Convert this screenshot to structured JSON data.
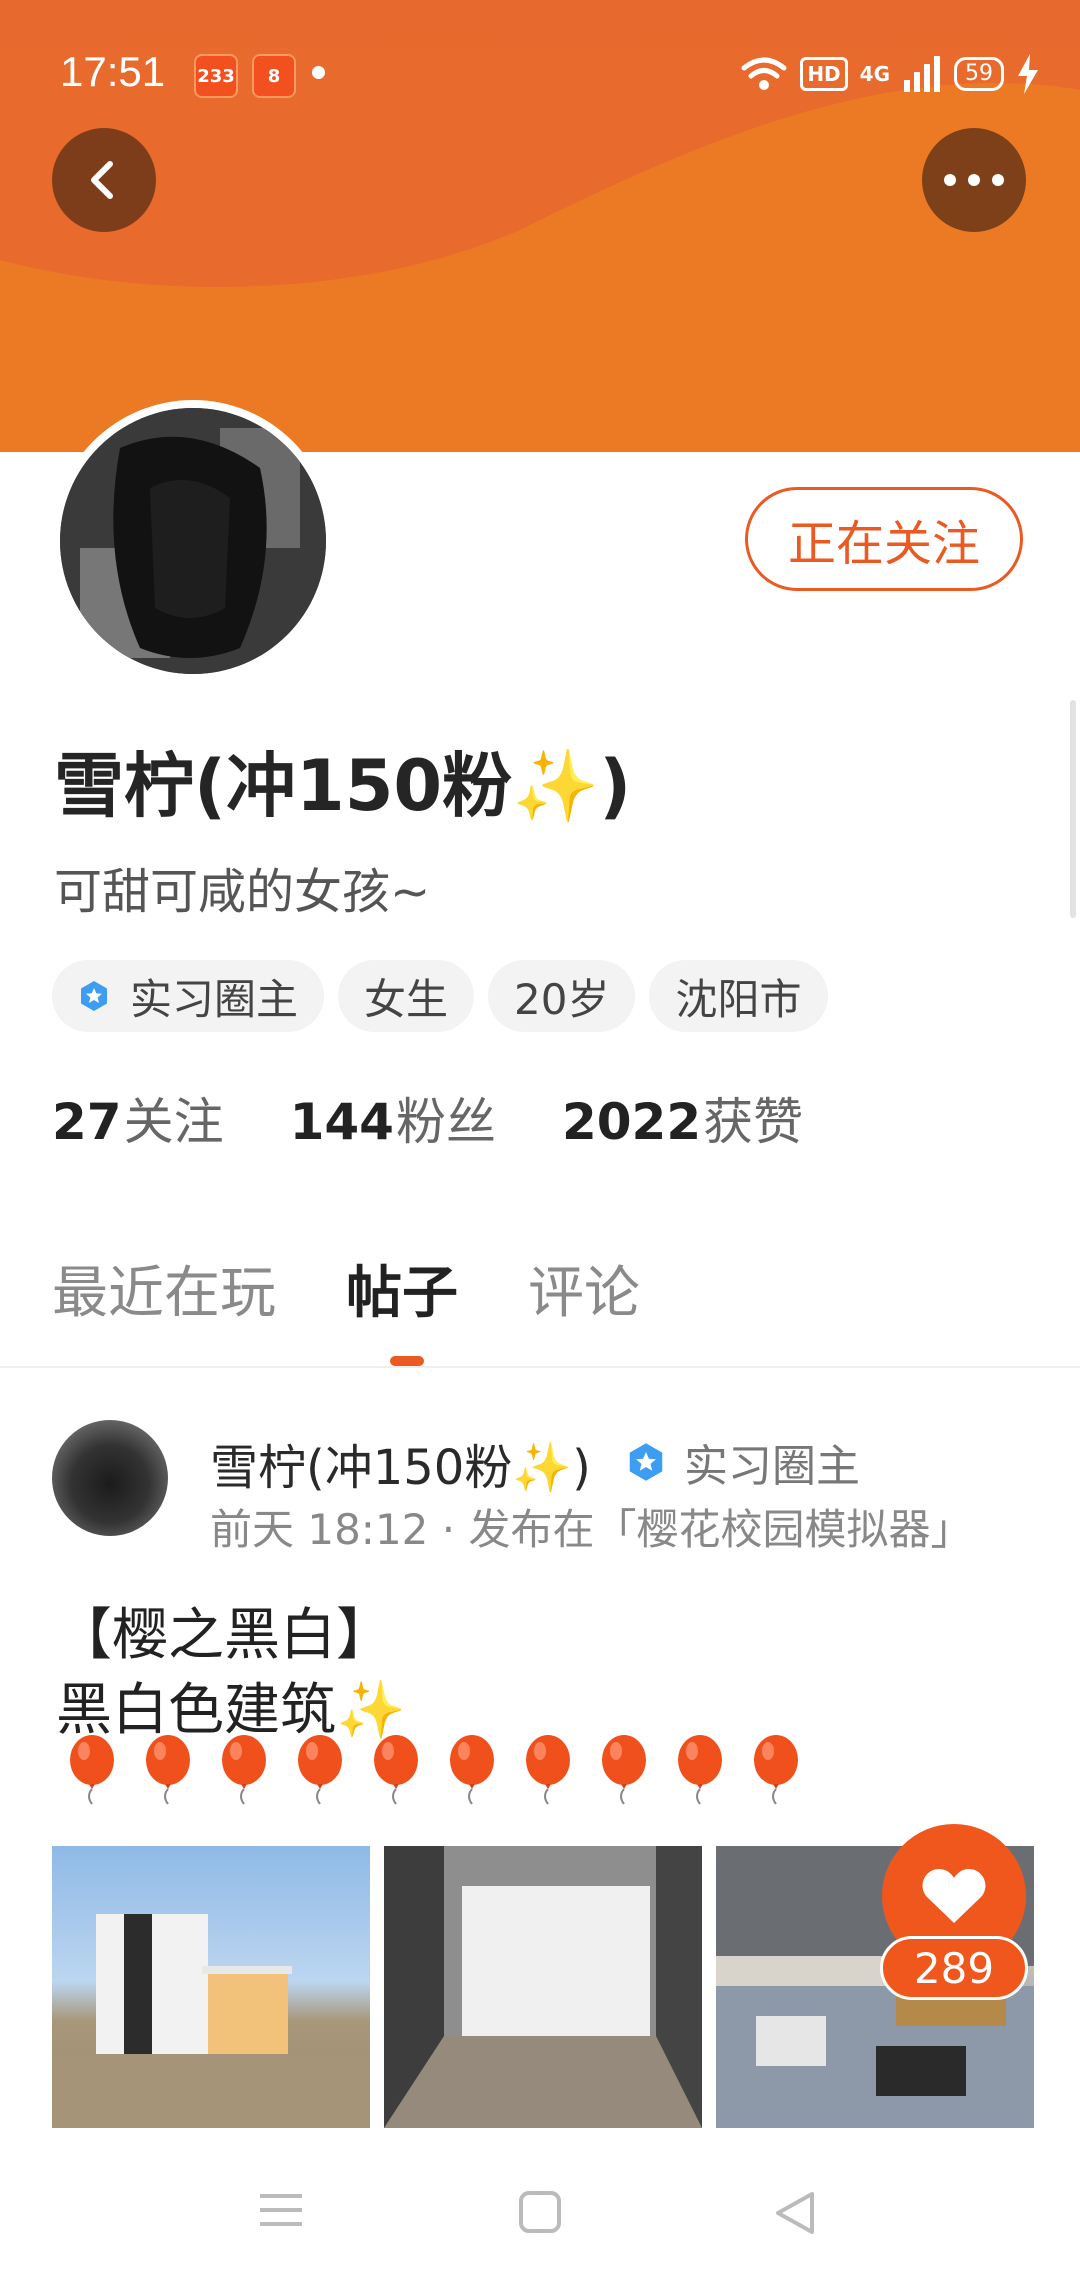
{
  "status": {
    "time": "17:51",
    "app_badge_1": "233",
    "app_badge_2": "8",
    "hd": "HD",
    "network": "4G",
    "battery": "59"
  },
  "profile": {
    "follow_button": "正在关注",
    "name": "雪柠(冲150粉✨)",
    "bio": "可甜可咸的女孩~",
    "tags": [
      "实习圈主",
      "女生",
      "20岁",
      "沈阳市"
    ],
    "stats": [
      {
        "num": "27",
        "label": "关注"
      },
      {
        "num": "144",
        "label": "粉丝"
      },
      {
        "num": "2022",
        "label": "获赞"
      }
    ]
  },
  "tabs": [
    "最近在玩",
    "帖子",
    "评论"
  ],
  "active_tab": "帖子",
  "post": {
    "author": "雪柠(冲150粉✨)",
    "badge": "实习圈主",
    "meta": "前天 18:12 · 发布在「樱花校园模拟器」",
    "title": "【樱之黑白】",
    "subtitle": "黑白色建筑✨",
    "balloon_count": 10,
    "likes": "289"
  },
  "icons": {
    "back": "chevron-left-icon",
    "more": "more-dots-icon",
    "like": "heart-icon",
    "badge": "star-badge-icon"
  },
  "colors": {
    "accent": "#ea5a22",
    "banner": "#ea7227"
  }
}
